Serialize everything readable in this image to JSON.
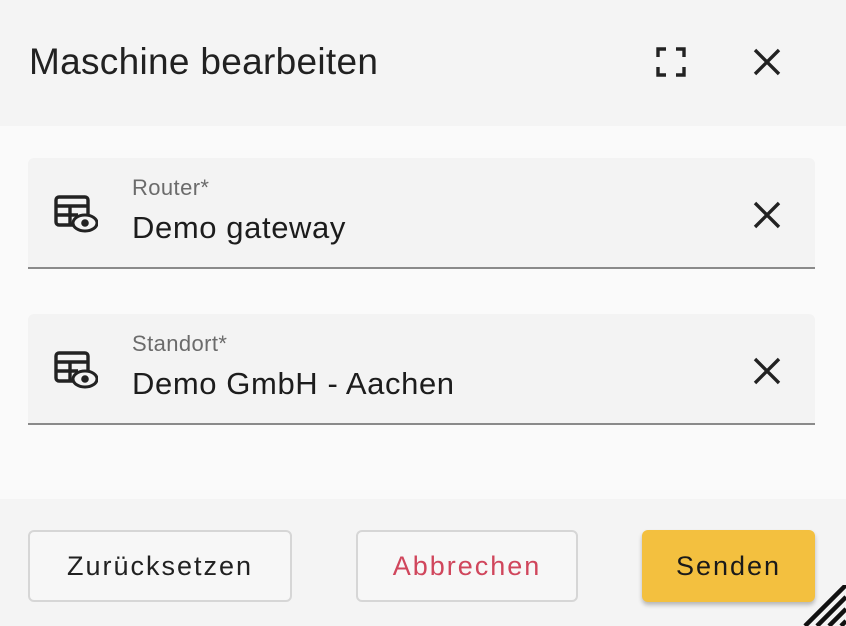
{
  "dialog": {
    "title": "Maschine bearbeiten",
    "fullscreen_icon": "fullscreen-icon",
    "close_icon": "close-icon"
  },
  "fields": [
    {
      "label": "Router*",
      "value": "Demo gateway",
      "icon": "table-eye-icon",
      "clear_icon": "close-icon"
    },
    {
      "label": "Standort*",
      "value": "Demo GmbH - Aachen",
      "icon": "table-eye-icon",
      "clear_icon": "close-icon"
    }
  ],
  "actions": {
    "reset_label": "Zurücksetzen",
    "cancel_label": "Abbrechen",
    "send_label": "Senden"
  },
  "colors": {
    "primary": "#f3c03f",
    "danger": "#d0465c"
  }
}
